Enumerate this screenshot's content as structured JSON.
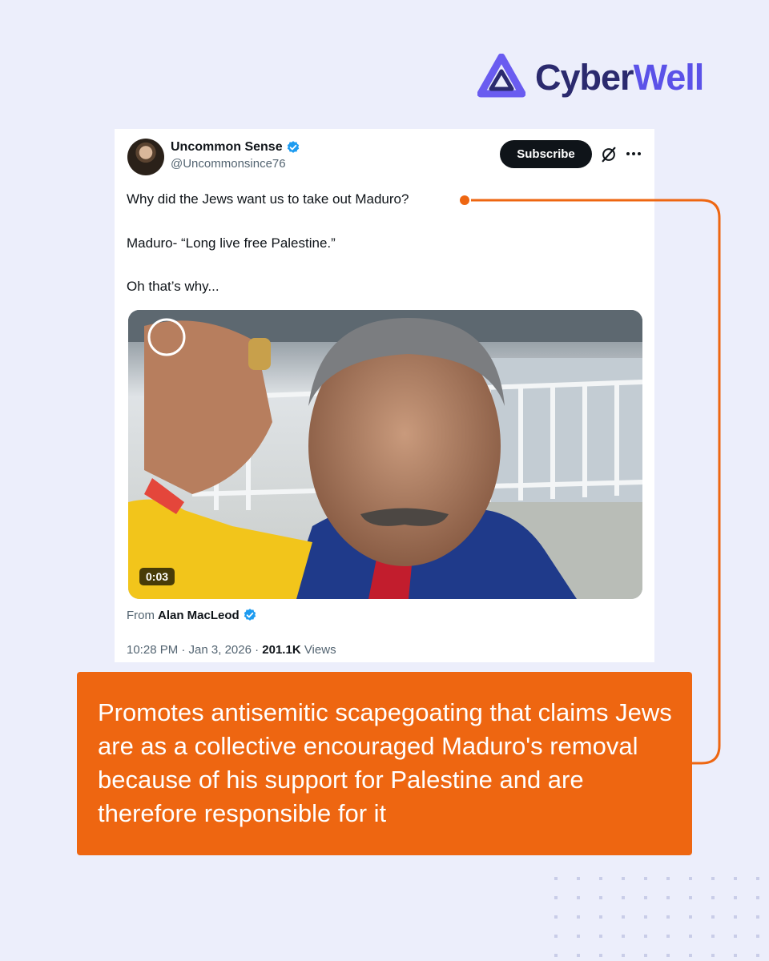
{
  "brand": {
    "name_part1": "Cyber",
    "name_part2": "Well",
    "logo_icon": "cyberwell-triangle-logo",
    "color_dark": "#2b2a6e",
    "color_accent": "#5b52e8"
  },
  "tweet": {
    "display_name": "Uncommon Sense",
    "handle": "@Uncommonsince76",
    "subscribe_label": "Subscribe",
    "lines": [
      "Why did the Jews want us to take out Maduro?",
      "Maduro- “Long live free Palestine.”",
      "Oh that’s why..."
    ],
    "video_duration": "0:03",
    "from_prefix": "From",
    "from_name": "Alan MacLeod",
    "time_date": "10:28 PM · Jan 3, 2026 ·",
    "views_count": "201.1K",
    "views_label": "Views"
  },
  "callout": {
    "text": "Promotes antisemitic scapegoating that claims Jews are as a collective encouraged Maduro's removal because of his support for Palestine and are therefore responsible for it",
    "color": "#ee6611"
  }
}
